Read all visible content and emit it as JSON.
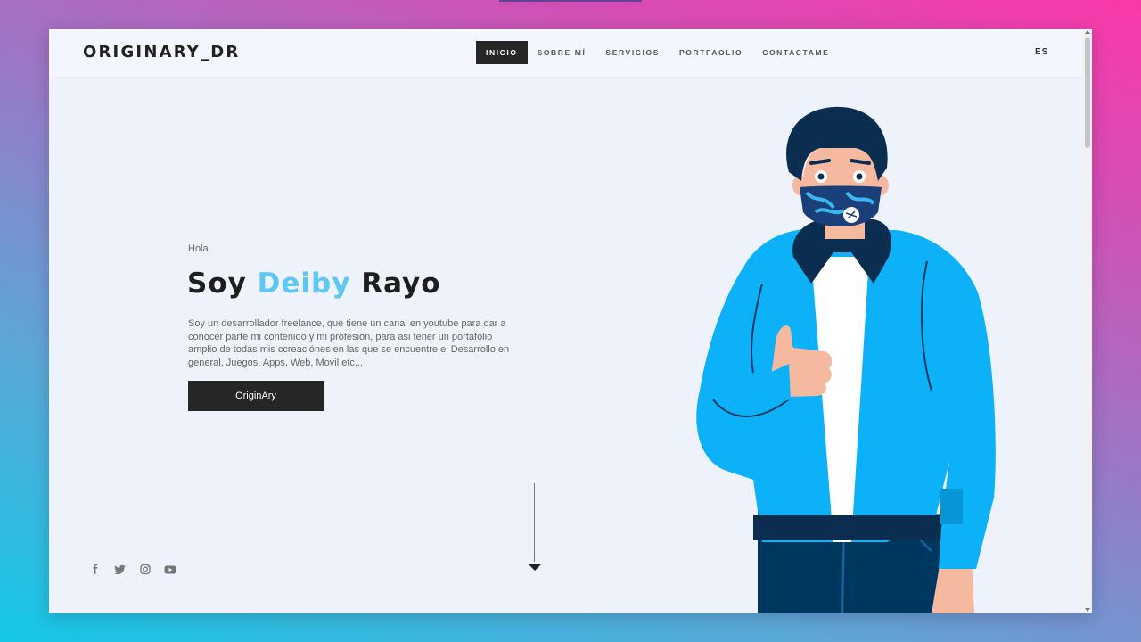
{
  "header": {
    "logo": "ORIGINARY_DR",
    "nav": [
      {
        "label": "INICIO",
        "active": true
      },
      {
        "label": "SOBRE MÍ",
        "active": false
      },
      {
        "label": "SERVICIOS",
        "active": false
      },
      {
        "label": "PORTFAOLIO",
        "active": false
      },
      {
        "label": "CONTACTAME",
        "active": false
      }
    ],
    "language": "ES"
  },
  "hero": {
    "greeting": "Hola",
    "title_prefix": "Soy ",
    "title_highlight": "Deiby",
    "title_suffix": " Rayo",
    "description": "Soy un desarrollador freelance, que tiene un canal en youtube para dar a conocer parte mi contenido y mi profesión, para asi tener un portafolio amplio de todas mis ccreaciónes en las que se encuentre el Desarrollo en general, Juegos, Apps, Web, Movil etc...",
    "cta_label": "OriginAry",
    "highlight_color": "#5bc8f5"
  },
  "social_icons": [
    "facebook-icon",
    "twitter-icon",
    "instagram-icon",
    "youtube-icon"
  ],
  "illustration": {
    "subject": "person-with-face-mask",
    "jacket_color": "#0cb1f7",
    "mask_color": "#1a3f7a"
  }
}
